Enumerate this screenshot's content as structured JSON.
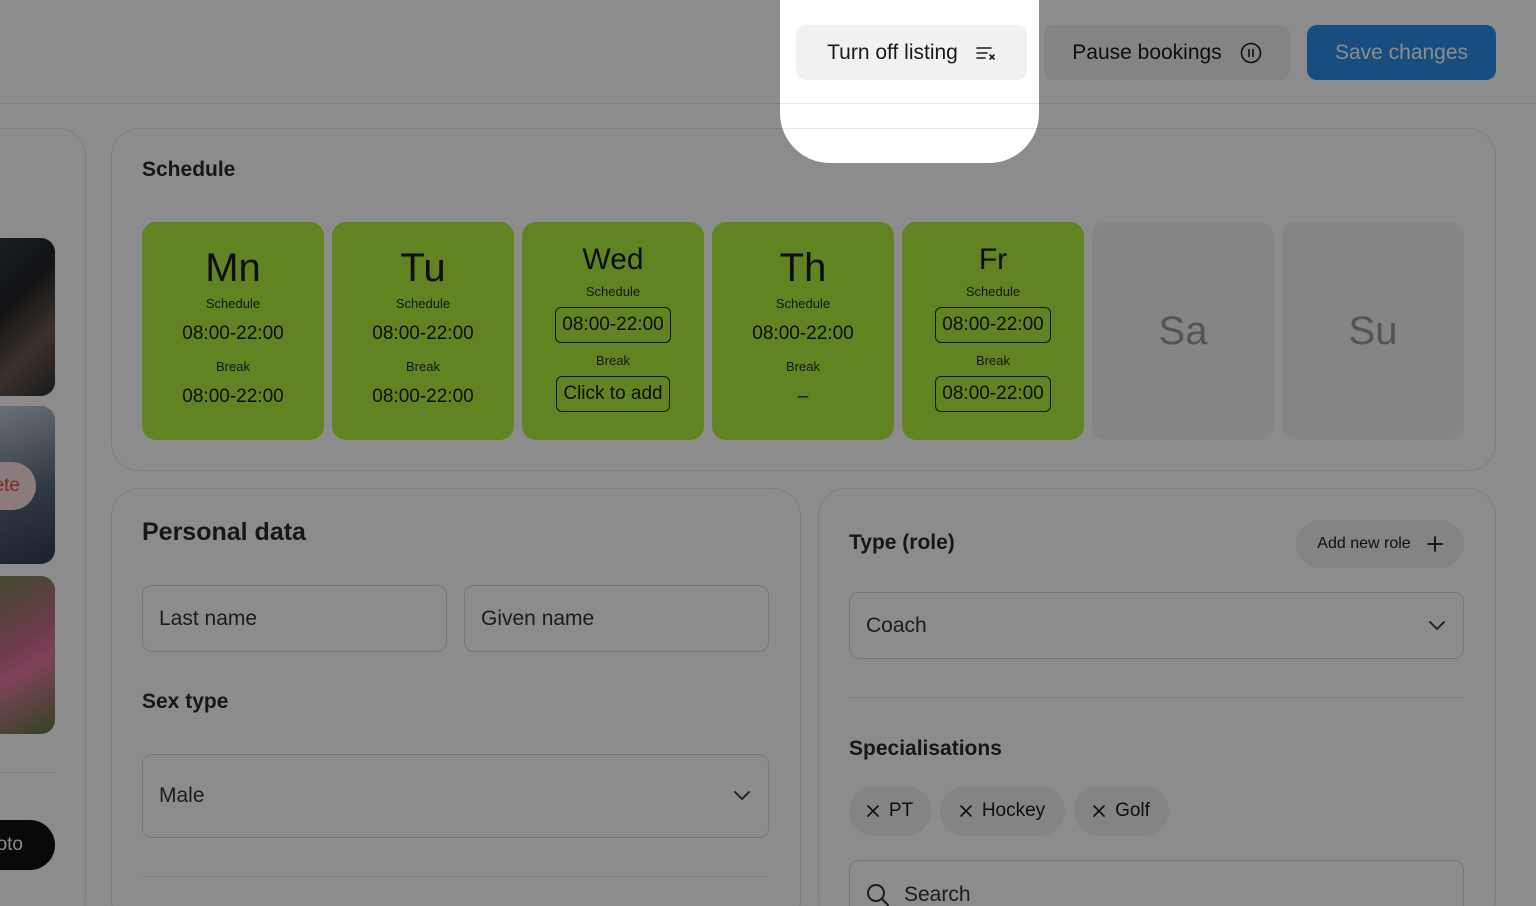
{
  "toolbar": {
    "turn_off_label": "Turn off listing",
    "pause_label": "Pause bookings",
    "save_label": "Save changes"
  },
  "left_panel": {
    "delete_label": "ete",
    "photo_button_label": "oto"
  },
  "schedule": {
    "title": "Schedule",
    "days": [
      {
        "name": "Mn",
        "schedule_label": "Schedule",
        "schedule": "08:00-22:00",
        "break_label": "Break",
        "break": "08:00-22:00"
      },
      {
        "name": "Tu",
        "schedule_label": "Schedule",
        "schedule": "08:00-22:00",
        "break_label": "Break",
        "break": "08:00-22:00"
      },
      {
        "name": "Wed",
        "schedule_label": "Schedule",
        "schedule": "08:00-22:00",
        "break_label": "Break",
        "break": "Click to add"
      },
      {
        "name": "Th",
        "schedule_label": "Schedule",
        "schedule": "08:00-22:00",
        "break_label": "Break",
        "break": "–"
      },
      {
        "name": "Fr",
        "schedule_label": "Schedule",
        "schedule": "08:00-22:00",
        "break_label": "Break",
        "break": "08:00-22:00"
      },
      {
        "name": "Sa"
      },
      {
        "name": "Su"
      }
    ]
  },
  "personal": {
    "title": "Personal data",
    "last_name_placeholder": "Last name",
    "given_name_placeholder": "Given name",
    "sex_title": "Sex type",
    "sex_value": "Male"
  },
  "role": {
    "title": "Type (role)",
    "add_label": "Add new role",
    "role_value": "Coach",
    "specialisations_title": "Specialisations",
    "chips": [
      "PT",
      "Hockey",
      "Golf"
    ],
    "search_placeholder": "Search"
  },
  "colors": {
    "accent_blue": "#2a8ee8",
    "day_green": "#b1ee3e",
    "overlay": "rgba(0,0,0,0.45)"
  }
}
